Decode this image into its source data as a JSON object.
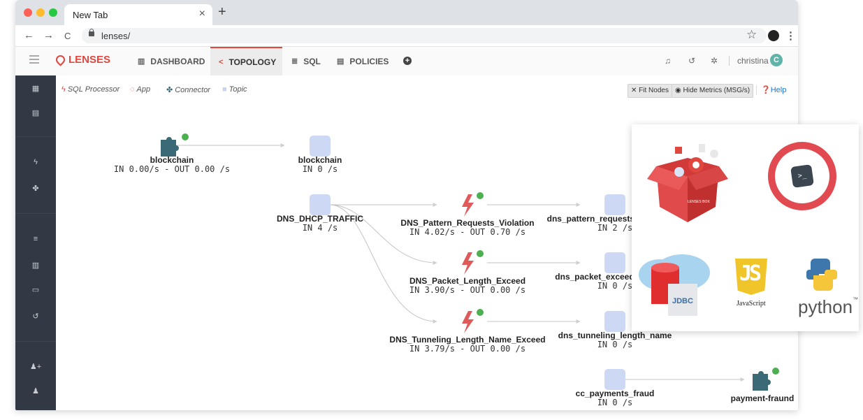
{
  "browser": {
    "tab_title": "New Tab",
    "tab_close": "×",
    "new_tab": "+",
    "back": "←",
    "forward": "→",
    "reload": "C",
    "url": "lenses/",
    "bookmark_icon": "☆",
    "menu_icon": "⋮",
    "traffic_lights": [
      "#fe5f57",
      "#febc2e",
      "#28c840"
    ]
  },
  "app": {
    "logo": "LENSES",
    "accent_color": "#e0473f",
    "nav": [
      {
        "label": "DASHBOARD",
        "icon": "bar-chart-icon",
        "active": false
      },
      {
        "label": "TOPOLOGY",
        "icon": "share-icon",
        "active": true
      },
      {
        "label": "SQL",
        "icon": "database-icon",
        "active": false
      },
      {
        "label": "POLICIES",
        "icon": "list-icon",
        "active": false
      }
    ],
    "add_icon": "plus-circle-icon",
    "user": "christina",
    "avatar_letter": "C"
  },
  "toolbar": {
    "legend": [
      {
        "label": "SQL Processor",
        "icon": "bolt-icon",
        "color": "#e0473f"
      },
      {
        "label": "App",
        "icon": "app-icon",
        "color": "#e0473f"
      },
      {
        "label": "Connector",
        "icon": "puzzle-icon",
        "color": "#3b6a76"
      },
      {
        "label": "Topic",
        "icon": "square-icon",
        "color": "#c7d3f2"
      }
    ],
    "fit_nodes": "Fit Nodes",
    "hide_metrics": "Hide Metrics (MSG/s)",
    "help": "Help"
  },
  "graph": {
    "colors": {
      "topic": "#cdd8f5",
      "connector": "#3b6a76",
      "processor": "#e05a5a",
      "status": "#4caf50",
      "edge": "#c4c4c4"
    },
    "nodes": [
      {
        "id": "blockchain-connector",
        "type": "connector",
        "label": "blockchain",
        "metrics": "IN 0.00/s - OUT 0.00 /s"
      },
      {
        "id": "blockchain-topic",
        "type": "topic",
        "label": "blockchain",
        "metrics": "IN 0 /s"
      },
      {
        "id": "dns-dhcp-topic",
        "type": "topic",
        "label": "DNS_DHCP_TRAFFIC",
        "metrics": "IN 4 /s"
      },
      {
        "id": "p1",
        "type": "processor",
        "label": "DNS_Pattern_Requests_Violation",
        "metrics": "IN 4.02/s - OUT 0.70 /s"
      },
      {
        "id": "p2",
        "type": "processor",
        "label": "DNS_Packet_Length_Exceed",
        "metrics": "IN 3.90/s - OUT 0.00 /s"
      },
      {
        "id": "p3",
        "type": "processor",
        "label": "DNS_Tunneling_Length_Name_Exceed",
        "metrics": "IN 3.79/s - OUT 0.00 /s"
      },
      {
        "id": "t1",
        "type": "topic",
        "label": "dns_pattern_requests_v",
        "metrics": "IN 2 /s"
      },
      {
        "id": "t2",
        "type": "topic",
        "label": "dns_packet_exceed_l",
        "metrics": "IN 0 /s"
      },
      {
        "id": "t3",
        "type": "topic",
        "label": "dns_tunneling_length_name",
        "metrics": "IN 0 /s"
      },
      {
        "id": "cc-topic",
        "type": "topic",
        "label": "cc_payments_fraud",
        "metrics": "IN 0 /s"
      },
      {
        "id": "pf-connector",
        "type": "connector",
        "label": "payment-fraund",
        "metrics": ""
      }
    ]
  },
  "overlay": {
    "box_label": "LENSES BOX",
    "cli_prompt": ">_",
    "jdbc": "JDBC",
    "js_letters": "JS",
    "javascript": "JavaScript",
    "python": "python",
    "python_tm": "™"
  }
}
